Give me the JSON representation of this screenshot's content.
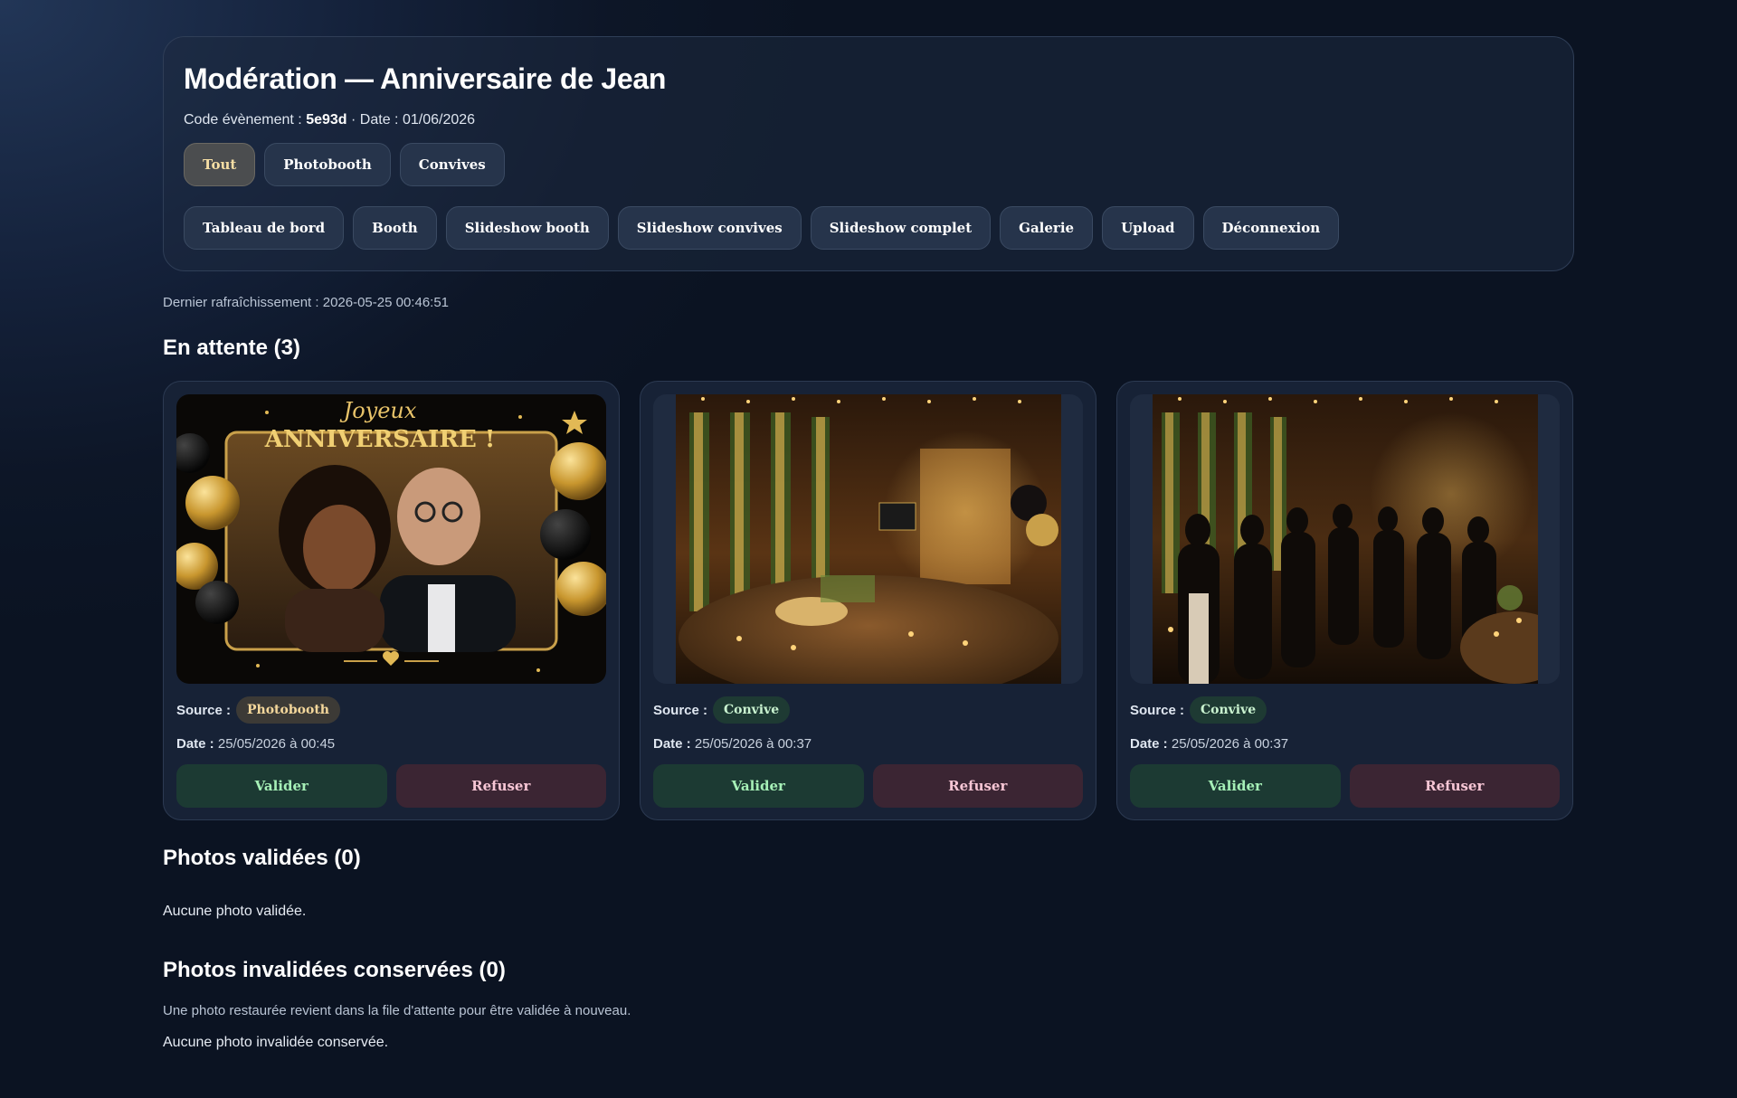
{
  "header": {
    "title": "Modération — Anniversaire de Jean",
    "code_label": "Code évènement :",
    "code_value": "5e93d",
    "date_label": "· Date :",
    "date_value": "01/06/2026"
  },
  "filters": [
    {
      "label": "Tout",
      "active": true
    },
    {
      "label": "Photobooth",
      "active": false
    },
    {
      "label": "Convives",
      "active": false
    }
  ],
  "nav": [
    {
      "label": "Tableau de bord"
    },
    {
      "label": "Booth"
    },
    {
      "label": "Slideshow booth"
    },
    {
      "label": "Slideshow convives"
    },
    {
      "label": "Slideshow complet"
    },
    {
      "label": "Galerie"
    },
    {
      "label": "Upload"
    },
    {
      "label": "Déconnexion"
    }
  ],
  "refresh": "Dernier rafraîchissement : 2026-05-25 00:46:51",
  "pending": {
    "title": "En attente (3)",
    "items": [
      {
        "source_label": "Source :",
        "source": "Photobooth",
        "date_label": "Date :",
        "date": "25/05/2026 à 00:45",
        "validate": "Valider",
        "refuse": "Refuser",
        "frame_text_1": "Joyeux",
        "frame_text_2": "ANNIVERSAIRE !"
      },
      {
        "source_label": "Source :",
        "source": "Convive",
        "date_label": "Date :",
        "date": "25/05/2026 à 00:37",
        "validate": "Valider",
        "refuse": "Refuser"
      },
      {
        "source_label": "Source :",
        "source": "Convive",
        "date_label": "Date :",
        "date": "25/05/2026 à 00:37",
        "validate": "Valider",
        "refuse": "Refuser"
      }
    ]
  },
  "validated": {
    "title": "Photos validées (0)",
    "empty": "Aucune photo validée."
  },
  "invalidated": {
    "title": "Photos invalidées conservées (0)",
    "hint": "Une photo restaurée revient dans la file d'attente pour être validée à nouveau.",
    "empty": "Aucune photo invalidée conservée."
  },
  "colors": {
    "accent_gold": "#f6dea4",
    "validate_text": "#a6f0b7",
    "refuse_text": "#f7c6d5"
  }
}
